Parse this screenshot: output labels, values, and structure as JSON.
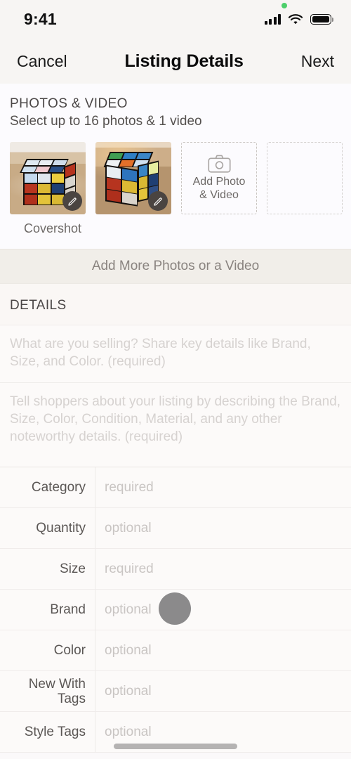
{
  "status_bar": {
    "time": "9:41",
    "icons": [
      "recording-dot",
      "cellular-signal",
      "wifi",
      "battery"
    ]
  },
  "navbar": {
    "cancel_label": "Cancel",
    "title": "Listing Details",
    "next_label": "Next"
  },
  "photos_section": {
    "heading": "PHOTOS & VIDEO",
    "subheading": "Select up to 16 photos & 1 video",
    "covershot_label": "Covershot",
    "add_photo_line1": "Add Photo",
    "add_photo_line2": "& Video",
    "add_more_label": "Add More Photos or a Video",
    "photos": [
      {
        "alt": "rubiks-cube-front-view",
        "badge_icon": "pencil-icon"
      },
      {
        "alt": "rubiks-cube-angled-view",
        "badge_icon": "pencil-icon"
      }
    ]
  },
  "details_section": {
    "heading": "DETAILS",
    "title_placeholder": "What are you selling? Share key details like Brand, Size, and Color. (required)",
    "description_placeholder": "Tell shoppers about your listing by describing the Brand, Size, Color, Condition, Material, and any other noteworthy details. (required)",
    "rows": [
      {
        "label": "Category",
        "value": "required"
      },
      {
        "label": "Quantity",
        "value": "optional"
      },
      {
        "label": "Size",
        "value": "required"
      },
      {
        "label": "Brand",
        "value": "optional"
      },
      {
        "label": "Color",
        "value": "optional"
      },
      {
        "label": "New With\nTags",
        "value": "optional"
      },
      {
        "label": "Style Tags",
        "value": "optional"
      }
    ]
  },
  "colors": {
    "nav_background": "#f7f5f3",
    "page_background": "#fcfaf9",
    "add_more_band": "#f1eee9",
    "placeholder_text": "#c9c5c3",
    "label_text": "#5b5755",
    "recording_dot": "#4ccf6a",
    "touch_indicator": "#8b8a8b"
  }
}
